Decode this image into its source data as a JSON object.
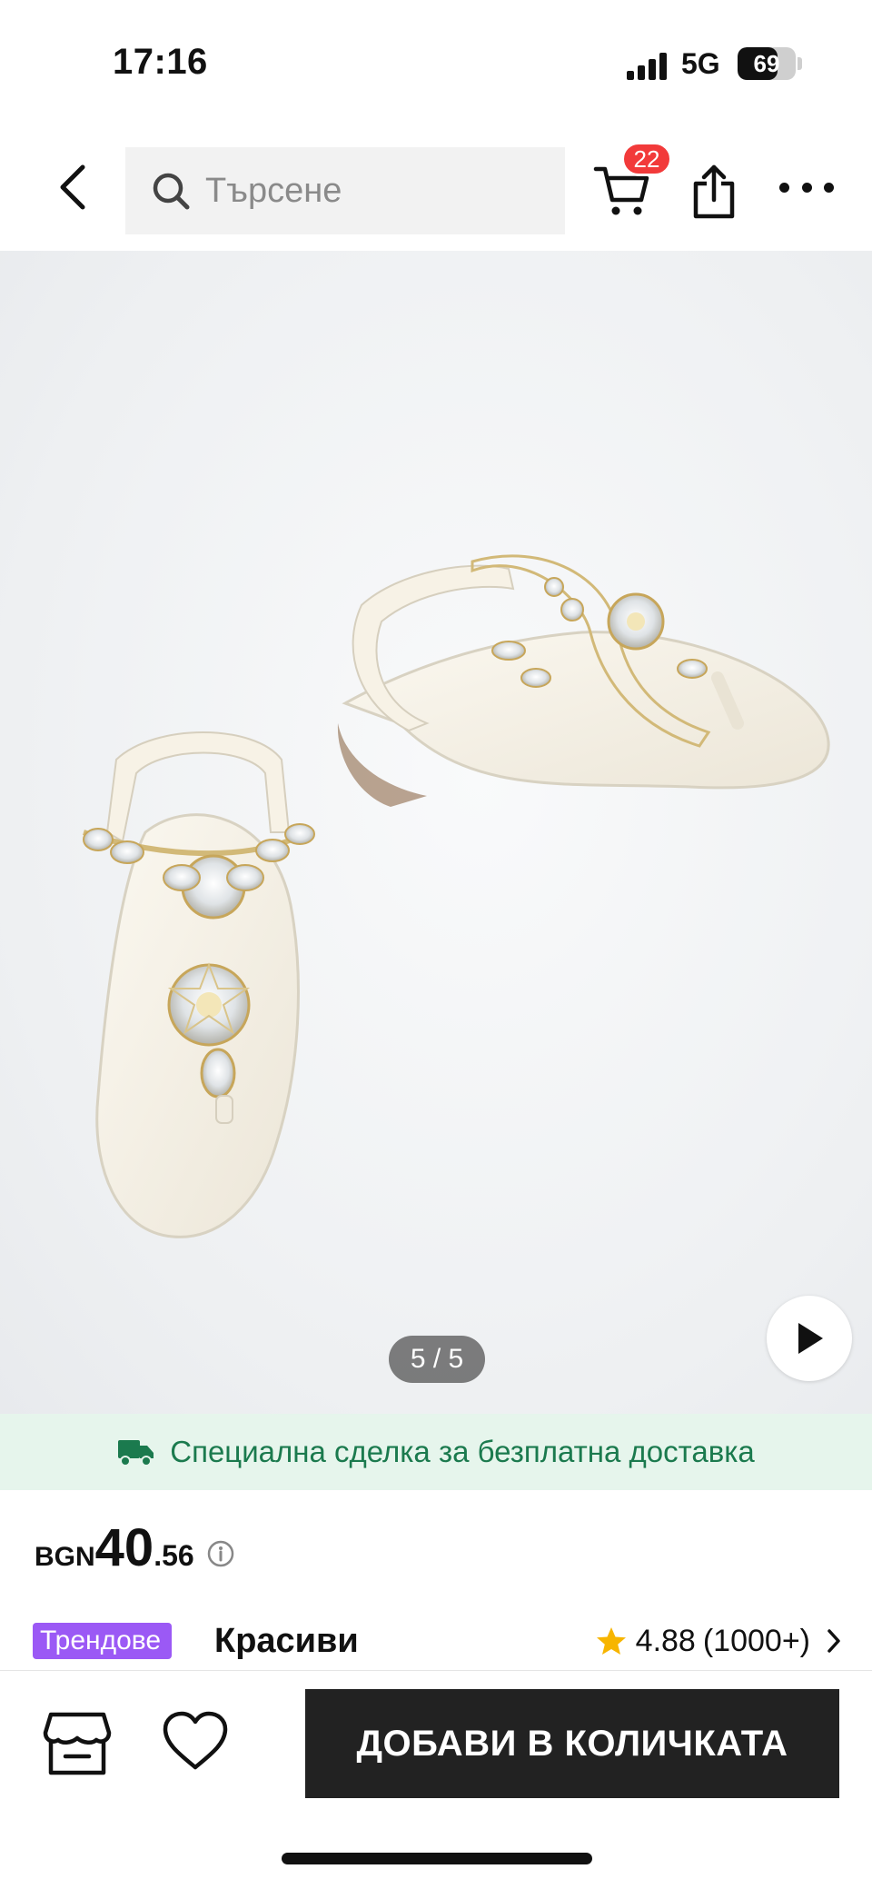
{
  "status_bar": {
    "time": "17:16",
    "network": "5G",
    "battery_level": "69",
    "battery_fraction": 0.69
  },
  "header": {
    "search_placeholder": "Търсене",
    "cart_count": "22"
  },
  "gallery": {
    "page_indicator": "5 / 5"
  },
  "shipping_banner": {
    "text": "Специална сделка за безплатна доставка",
    "color": "#1b7a4e"
  },
  "price": {
    "currency": "BGN",
    "integer": "40",
    "decimal": ".56"
  },
  "product": {
    "trend_badge": "Трендове",
    "title": "Красиви",
    "rating": "4.88",
    "review_count": "(1000+)"
  },
  "bottom_bar": {
    "add_to_cart_label": "ДОБАВИ В КОЛИЧКАТА"
  },
  "icons": [
    "back-arrow-icon",
    "search-icon",
    "cart-icon",
    "share-icon",
    "more-icon",
    "play-icon",
    "truck-icon",
    "info-icon",
    "star-icon",
    "chevron-right-icon",
    "store-icon",
    "heart-icon"
  ]
}
